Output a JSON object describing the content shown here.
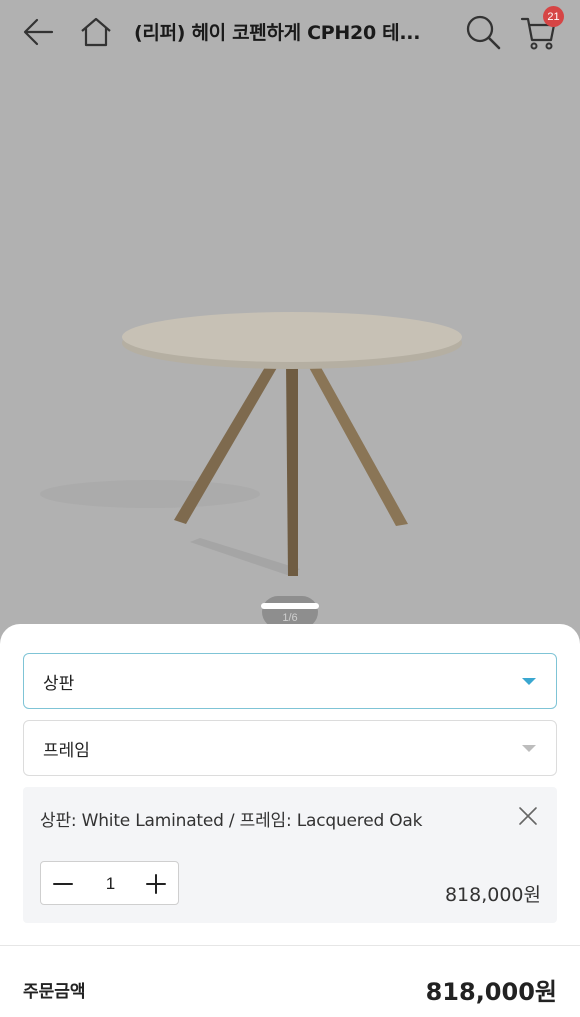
{
  "header": {
    "title": "(리퍼) 헤이 코펜하게 CPH20 테...",
    "cart_count": "21",
    "icons": [
      "back-arrow-icon",
      "home-icon",
      "search-icon",
      "cart-icon"
    ]
  },
  "gallery": {
    "counter": "1/6"
  },
  "options": {
    "top": {
      "placeholder": "상판",
      "state": "active"
    },
    "frame": {
      "placeholder": "프레임"
    }
  },
  "selected_item": {
    "label": "상판: White Laminated / 프레임: Lacquered Oak",
    "quantity": "1",
    "price": "818,000원"
  },
  "summary": {
    "total_label": "주문금액",
    "total_value": "818,000원"
  },
  "colors": {
    "background": "#b1b1b1",
    "accent_border": "#7fc4d6",
    "accent_caret": "#3aa7d0",
    "badge": "#d64545"
  }
}
